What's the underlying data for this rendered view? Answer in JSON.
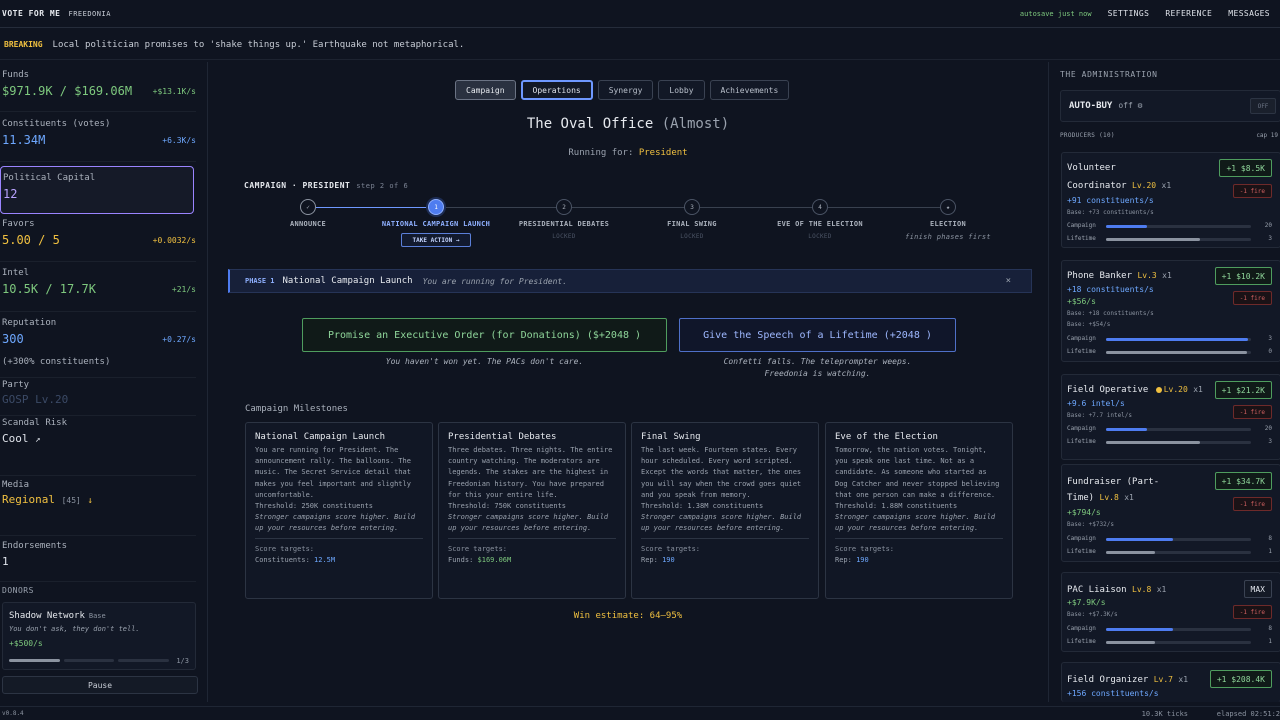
{
  "topbar": {
    "brand": "VOTE FOR ME",
    "country": "FREEDONIA",
    "autosave": "autosave just now",
    "nav": [
      "SETTINGS",
      "REFERENCE",
      "MESSAGES"
    ]
  },
  "breaking": {
    "tag": "BREAKING",
    "message": "Local politician promises to 'shake things up.' Earthquake not metaphorical."
  },
  "stats": {
    "funds": {
      "label": "Funds",
      "value": "$971.9K / $169.06M",
      "rate": "+$13.1K/s"
    },
    "constituents": {
      "label": "Constituents (votes)",
      "value": "11.34M",
      "rate": "+6.3K/s"
    },
    "political_capital": {
      "label": "Political Capital",
      "value": "12"
    },
    "favors": {
      "label": "Favors",
      "value": "5.00 / 5",
      "rate": "+0.0032/s"
    },
    "intel": {
      "label": "Intel",
      "value": "10.5K / 17.7K",
      "rate": "+21/s"
    },
    "reputation": {
      "label": "Reputation",
      "value": "300",
      "rate": "+0.27/s",
      "note": "(+300% constituents)"
    },
    "party": {
      "label": "Party",
      "value": "GOSP Lv.20"
    },
    "scandal": {
      "label": "Scandal Risk",
      "value": "Cool",
      "arrow": "↗"
    },
    "media": {
      "label": "Media",
      "value": "Regional",
      "detail": "[45]",
      "arrow": "↓"
    },
    "endorsements": {
      "label": "Endorsements",
      "value": "1"
    }
  },
  "donors": {
    "header": "DONORS",
    "card": {
      "name": "Shadow Network",
      "tier": "Base",
      "desc": "You don't ask, they don't tell.",
      "rate": "+$500/s",
      "count": "1/3",
      "filled": 1,
      "total": 3
    },
    "pause": "Pause"
  },
  "tabs": [
    "Campaign",
    "Operations",
    "Synergy",
    "Lobby",
    "Achievements"
  ],
  "office": {
    "title": "The Oval Office",
    "almost": "(Almost)"
  },
  "running": {
    "label": "Running for:",
    "value": "President"
  },
  "campaign": {
    "head": "CAMPAIGN · PRESIDENT",
    "step": "step 2 of 6"
  },
  "stepper": [
    {
      "icon": "✓",
      "label": "ANNOUNCE",
      "sub": ""
    },
    {
      "icon": "1",
      "label": "NATIONAL CAMPAIGN LAUNCH",
      "sub": ""
    },
    {
      "icon": "2",
      "label": "PRESIDENTIAL DEBATES",
      "sub": "LOCKED"
    },
    {
      "icon": "3",
      "label": "FINAL SWING",
      "sub": "LOCKED"
    },
    {
      "icon": "4",
      "label": "EVE OF THE ELECTION",
      "sub": "LOCKED"
    },
    {
      "icon": "★",
      "label": "ELECTION",
      "sub": "finish phases first"
    }
  ],
  "take_action": "TAKE ACTION →",
  "phase": {
    "tag": "PHASE 1",
    "name": "National Campaign Launch",
    "note": "You are running for President.",
    "close": "×"
  },
  "actions": {
    "order": {
      "label": "Promise an Executive Order (for Donations) ($+2048 )",
      "note": "You haven't won yet. The PACs don't care."
    },
    "speech": {
      "label": "Give the Speech of a Lifetime (+2048 )",
      "note1": "Confetti falls. The teleprompter weeps.",
      "note2": "Freedonia is watching."
    }
  },
  "milestones": {
    "header": "Campaign Milestones",
    "cards": [
      {
        "title": "National Campaign Launch",
        "desc": "You are running for President. The announcement rally. The balloons. The music. The Secret Service detail that makes you feel important and slightly uncomfortable.",
        "threshold": "Threshold: 250K constituents",
        "italic": "Stronger campaigns score higher. Build up your resources before entering.",
        "score_label": "Score targets:",
        "score_key": "Constituents:",
        "score_val": "12.5M"
      },
      {
        "title": "Presidential Debates",
        "desc": "Three debates. Three nights. The entire country watching. The moderators are legends. The stakes are the highest in Freedonian history. You have prepared for this your entire life.",
        "threshold": "Threshold: 750K constituents",
        "italic": "Stronger campaigns score higher. Build up your resources before entering.",
        "score_label": "Score targets:",
        "score_key": "Funds:",
        "score_val": "$169.06M"
      },
      {
        "title": "Final Swing",
        "desc": "The last week. Fourteen states. Every hour scheduled. Every word scripted. Except the words that matter, the ones you will say when the crowd goes quiet and you speak from memory.",
        "threshold": "Threshold: 1.38M constituents",
        "italic": "Stronger campaigns score higher. Build up your resources before entering.",
        "score_label": "Score targets:",
        "score_key": "Rep:",
        "score_val": "190"
      },
      {
        "title": "Eve of the Election",
        "desc": "Tomorrow, the nation votes. Tonight, you speak one last time. Not as a candidate. As someone who started as Dog Catcher and never stopped believing that one person can make a difference.",
        "threshold": "Threshold: 1.88M constituents",
        "italic": "Stronger campaigns score higher. Build up your resources before entering.",
        "score_label": "Score targets:",
        "score_key": "Rep:",
        "score_val": "190"
      }
    ]
  },
  "win": {
    "label": "Win estimate:",
    "value": "64–95%"
  },
  "admin": {
    "header": "THE ADMINISTRATION",
    "autobuy": {
      "label": "AUTO-BUY",
      "state": "off ⚙",
      "button": "OFF"
    },
    "producers": "PRODUCERS (10)",
    "cap": "cap 19"
  },
  "producers": [
    {
      "name1": "Volunteer",
      "name2": "Coordinator",
      "lv": "Lv.20",
      "x": "x1",
      "buy": "+1 $8.5K",
      "fire": "-1 fire",
      "rate1": "+91 constituents/s",
      "base1": "Base: +73 constituents/s",
      "campaign": "20",
      "lifetime": "3",
      "campaign_fill": 0.28,
      "lifetime_fill": 0.65
    },
    {
      "name1": "Phone Banker",
      "lv": "Lv.3",
      "x": "x1",
      "buy": "+1 $10.2K",
      "fire": "-1 fire",
      "rate1": "+18 constituents/s",
      "rate2": "+$56/s",
      "base1": "Base: +18 constituents/s",
      "base2": "Base: +$54/s",
      "campaign": "3",
      "lifetime": "0",
      "campaign_fill": 0.98,
      "lifetime_fill": 0.97
    },
    {
      "name1": "Field Operative",
      "lv": "Lv.20",
      "x": "x1",
      "buy": "+1 $21.2K",
      "fire": "-1 fire",
      "rate1": "+9.6 intel/s",
      "base1": "Base: +7.7 intel/s",
      "campaign": "20",
      "lifetime": "3",
      "campaign_fill": 0.28,
      "lifetime_fill": 0.65
    },
    {
      "name1": "Fundraiser (Part-",
      "name2": "Time)",
      "lv": "Lv.8",
      "x": "x1",
      "buy": "+1 $34.7K",
      "fire": "-1 fire",
      "rate1": "+$794/s",
      "base1": "Base: +$732/s",
      "campaign": "8",
      "lifetime": "1",
      "campaign_fill": 0.46,
      "lifetime_fill": 0.34
    },
    {
      "name1": "PAC Liaison",
      "lv": "Lv.8",
      "x": "x1",
      "buy": "MAX",
      "fire": "-1 fire",
      "rate1": "+$7.9K/s",
      "base1": "Base: +$7.3K/s",
      "campaign": "8",
      "lifetime": "1",
      "campaign_fill": 0.46,
      "lifetime_fill": 0.34
    },
    {
      "name1": "Field Organizer",
      "lv": "Lv.7",
      "x": "x1",
      "buy": "+1 $208.4K",
      "fire": "-1 fire",
      "rate1": "+156 constituents/s"
    }
  ],
  "footer": {
    "version": "v0.8.4",
    "ticks": "10.3K ticks",
    "elapsed": "elapsed 02:51:2"
  }
}
